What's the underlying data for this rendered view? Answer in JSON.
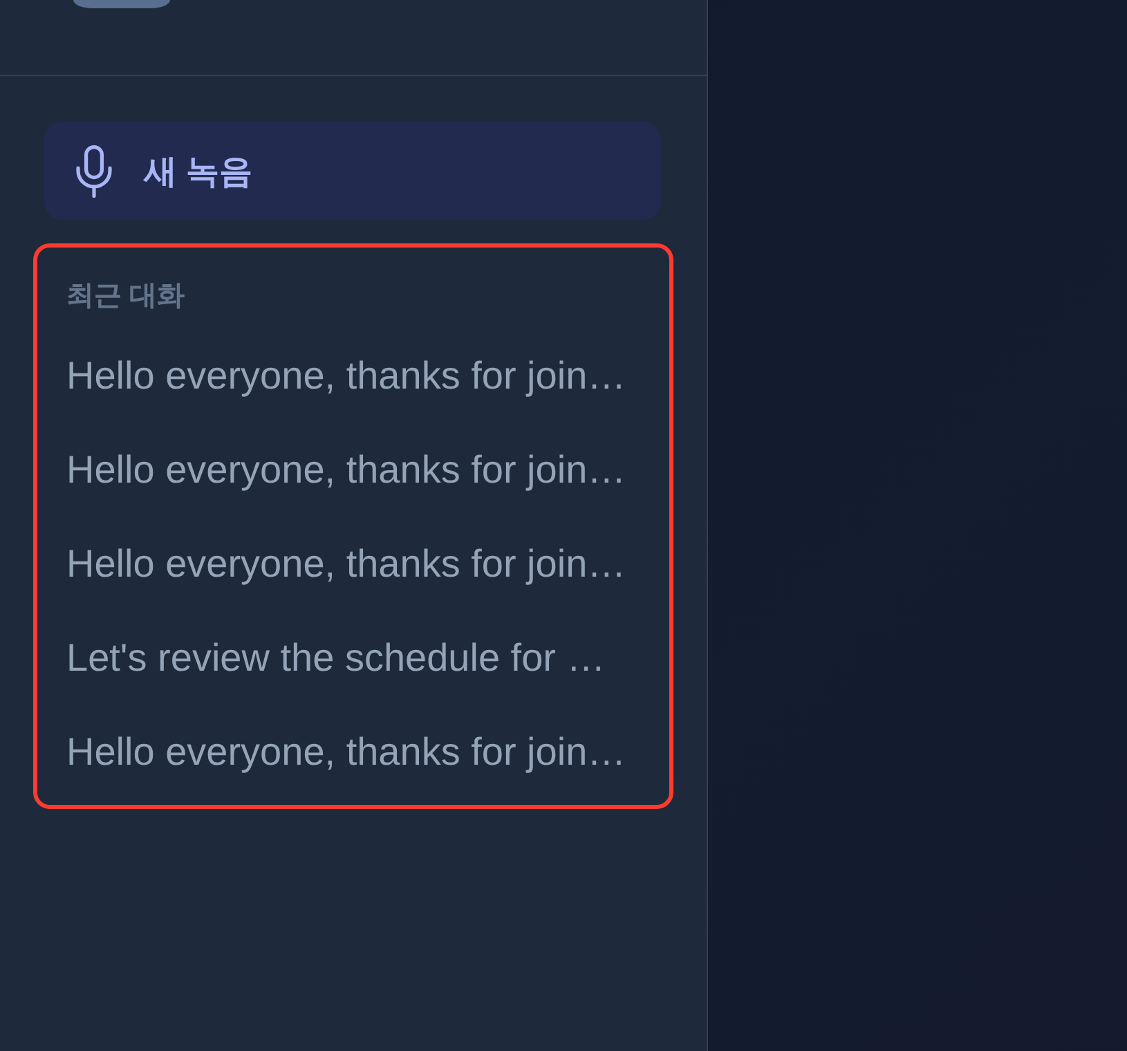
{
  "sidebar": {
    "new_recording_button": {
      "label": "새 녹음"
    },
    "recent": {
      "highlighted": true,
      "heading": "최근 대화",
      "items": [
        {
          "title": "Hello everyone, thanks for join…",
          "selected": false
        },
        {
          "title": "Hello everyone, thanks for join…",
          "selected": false
        },
        {
          "title": "Hello everyone, thanks for join…",
          "selected": false
        },
        {
          "title": "Let's review the schedule for …",
          "selected": false
        },
        {
          "title": "Hello everyone, thanks for join…",
          "selected": false
        }
      ]
    }
  }
}
